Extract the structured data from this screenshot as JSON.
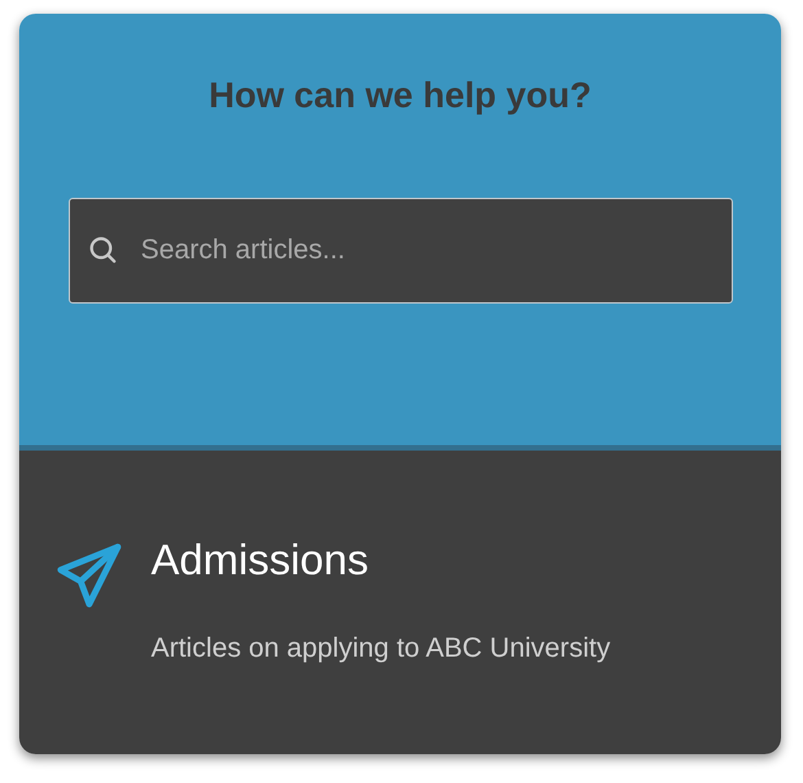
{
  "header": {
    "title": "How can we help you?"
  },
  "search": {
    "placeholder": "Search articles..."
  },
  "category": {
    "title": "Admissions",
    "description": "Articles on applying to ABC University"
  }
}
